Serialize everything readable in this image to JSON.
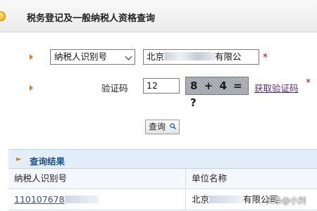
{
  "header": {
    "title": "税务登记及一般纳税人资格查询"
  },
  "form": {
    "id_type_select": {
      "value": "纳税人识别号"
    },
    "company_input": {
      "value_prefix": "北京",
      "value_suffix": "有限公"
    },
    "captcha_label": "验证码",
    "captcha_input": {
      "value": "12"
    },
    "captcha_image_text": "8 + 4 = ?",
    "refresh_link": "获取验证码",
    "required_mark": "*",
    "query_button": "查询"
  },
  "results": {
    "title": "查询结果",
    "columns": [
      "纳税人识别号",
      "单位名称"
    ],
    "rows": [
      {
        "taxpayer_id_prefix": "110107678",
        "company_prefix": "北京",
        "company_suffix": "有限公司"
      }
    ]
  },
  "watermark": "头条@小刘"
}
